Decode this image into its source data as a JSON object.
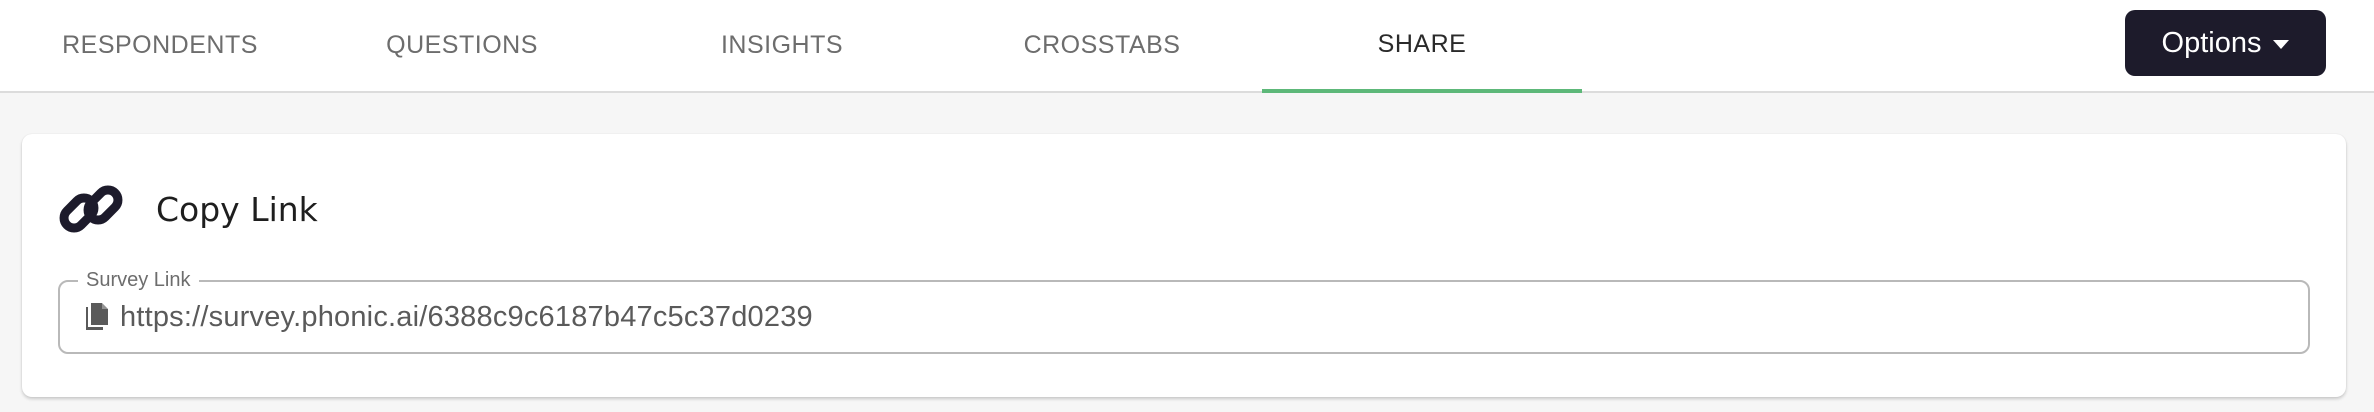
{
  "tabs": [
    {
      "label": "RESPONDENTS"
    },
    {
      "label": "QUESTIONS"
    },
    {
      "label": "INSIGHTS"
    },
    {
      "label": "CROSSTABS"
    },
    {
      "label": "SHARE",
      "active": true
    }
  ],
  "options_button": {
    "label": "Options",
    "icon": "caret-down-icon"
  },
  "share_card": {
    "title": "Copy Link",
    "icon": "link-icon",
    "survey_link": {
      "label": "Survey Link",
      "value": "https://survey.phonic.ai/6388c9c6187b47c5c37d0239",
      "icon": "copy-icon"
    }
  },
  "colors": {
    "active_tab_indicator": "#5db879",
    "options_button_bg": "#1d1b2b",
    "page_bg": "#f6f6f6"
  }
}
